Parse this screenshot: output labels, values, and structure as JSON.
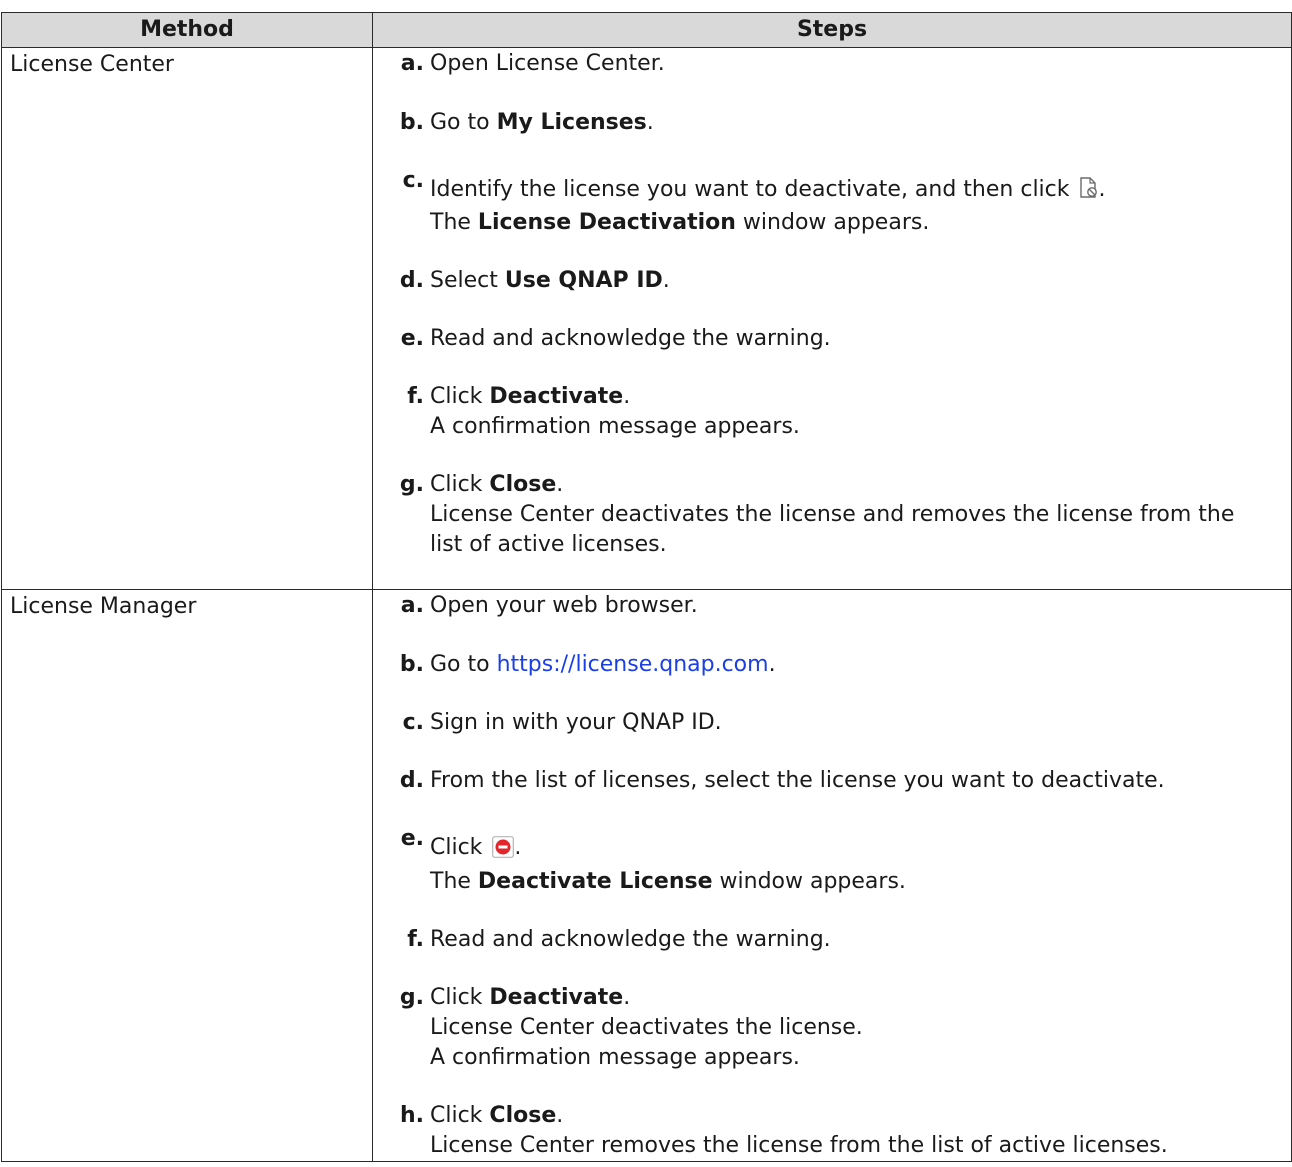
{
  "header": {
    "method": "Method",
    "steps": "Steps"
  },
  "rows": [
    {
      "method": "License Center",
      "steps": {
        "a": {
          "letter": "a.",
          "text": "Open License Center."
        },
        "b": {
          "letter": "b.",
          "pre": "Go to ",
          "bold": "My Licenses",
          "post": "."
        },
        "c": {
          "letter": "c.",
          "line1_pre": "Identify the license you want to deactivate, and then click",
          "line1_post": ".",
          "icon": "license-deactivate-icon",
          "line2_pre": "The ",
          "line2_bold": "License Deactivation",
          "line2_post": " window appears."
        },
        "d": {
          "letter": "d.",
          "pre": "Select ",
          "bold": "Use QNAP ID",
          "post": "."
        },
        "e": {
          "letter": "e.",
          "text": "Read and acknowledge the warning."
        },
        "f": {
          "letter": "f.",
          "pre": "Click ",
          "bold": "Deactivate",
          "post": ".",
          "line2": "A confirmation message appears."
        },
        "g": {
          "letter": "g.",
          "pre": "Click ",
          "bold": "Close",
          "post": ".",
          "line2": "License Center deactivates the license and removes the license from the",
          "line3": "list of active licenses."
        }
      }
    },
    {
      "method": "License Manager",
      "steps": {
        "a": {
          "letter": "a.",
          "text": "Open your web browser."
        },
        "b": {
          "letter": "b.",
          "pre": "Go to ",
          "link": "https://license.qnap.com",
          "post": "."
        },
        "c": {
          "letter": "c.",
          "text": "Sign in with your QNAP ID."
        },
        "d": {
          "letter": "d.",
          "text": "From the list of licenses, select the license you want to deactivate."
        },
        "e": {
          "letter": "e.",
          "pre": "Click",
          "post": ".",
          "icon": "red-stop-icon",
          "line2_pre": "The ",
          "line2_bold": "Deactivate License",
          "line2_post": " window appears."
        },
        "f": {
          "letter": "f.",
          "text": "Read and acknowledge the warning."
        },
        "g": {
          "letter": "g.",
          "pre": "Click ",
          "bold": "Deactivate",
          "post": ".",
          "line2": "License Center deactivates the license.",
          "line3": "A confirmation message appears."
        },
        "h": {
          "letter": "h.",
          "pre": "Click ",
          "bold": "Close",
          "post": ".",
          "line2": "License Center removes the license from the list of active licenses."
        }
      }
    }
  ],
  "colors": {
    "header_bg": "#d9d9d9",
    "link": "#1a3ee8",
    "stop_icon_red": "#e3262b",
    "border": "#2b2b2b"
  }
}
